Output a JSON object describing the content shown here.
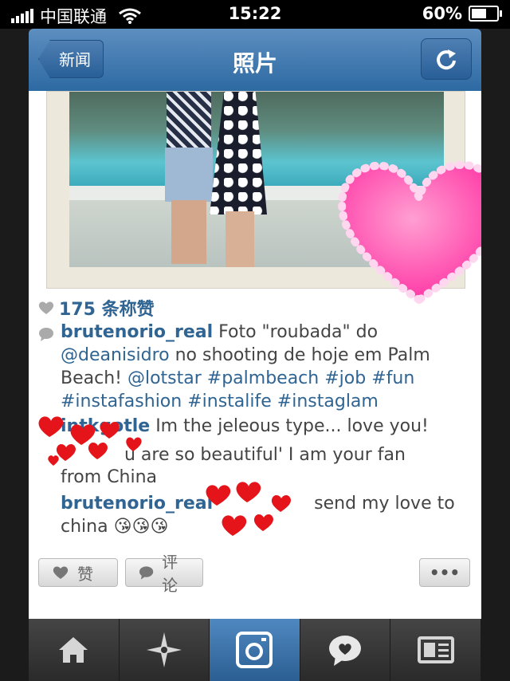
{
  "status_bar": {
    "carrier": "中国联通",
    "time": "15:22",
    "battery": "60%"
  },
  "nav": {
    "back_label": "新闻",
    "title": "照片"
  },
  "post": {
    "likes": "175 条称赞",
    "author": "brutenorio_real",
    "caption_lines": [
      " Foto \"roubada\" do",
      "@deanisidro",
      " no shooting de hoje em Palm",
      "Beach! ",
      "@lotstar",
      "#palmbeach",
      "#job",
      "#fun",
      "#instafashion",
      "#instalife",
      "#instaglam"
    ]
  },
  "comments": [
    {
      "user": "intkgotle",
      "text": " Im the jeleous type... love you!"
    },
    {
      "user": "",
      "text": "u are so beautiful' I am your fan"
    },
    {
      "user": "",
      "text": "from China"
    },
    {
      "user": "brutenorio_real",
      "text": " send my love to"
    },
    {
      "user": "",
      "text": "china 😘😘😘"
    }
  ],
  "actions": {
    "like_label": "赞",
    "comment_label": "评论",
    "more_label": "•••"
  },
  "colors": {
    "nav_blue": "#2d6aa2",
    "link_blue": "#2f6493",
    "heart_pink": "#ff4fae"
  }
}
